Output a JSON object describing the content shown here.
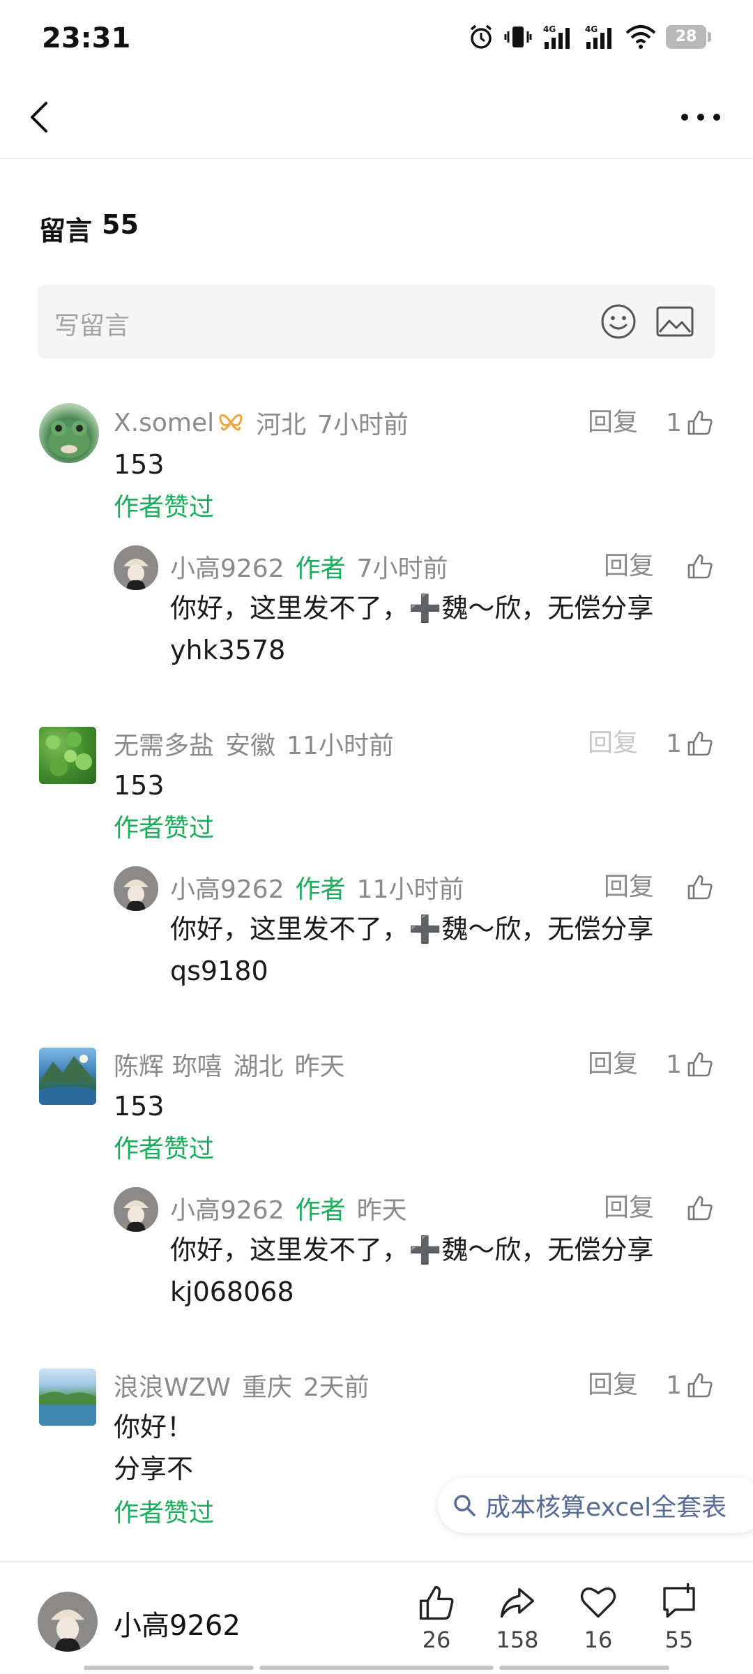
{
  "status": {
    "time": "23:31",
    "battery": "28",
    "net1": "4G",
    "net2": "4G"
  },
  "nav": {
    "back_icon": "chevron-left-icon",
    "more_icon": "more-dots-icon"
  },
  "comments_header": {
    "label": "留言",
    "count": "55"
  },
  "input": {
    "placeholder": "写留言"
  },
  "comments": [
    {
      "user": "X.somel",
      "region": "河北",
      "time": "7小时前",
      "reply": "回复",
      "likes": "1",
      "text": "153",
      "liked_by_author": "作者赞过",
      "author_reply": {
        "user": "小高9262",
        "tag": "作者",
        "time": "7小时前",
        "reply": "回复",
        "line1": "你好，这里发不了，➕魏～欣，无偿分享",
        "line2": "yhk3578"
      }
    },
    {
      "user": "无需多盐",
      "region": "安徽",
      "time": "11小时前",
      "reply": "回复",
      "likes": "1",
      "text": "153",
      "liked_by_author": "作者赞过",
      "author_reply": {
        "user": "小高9262",
        "tag": "作者",
        "time": "11小时前",
        "reply": "回复",
        "line1": "你好，这里发不了，➕魏～欣，无偿分享",
        "line2": "qs9180"
      }
    },
    {
      "user": "陈辉 珎嘻",
      "region": "湖北",
      "time": "昨天",
      "reply": "回复",
      "likes": "1",
      "text": "153",
      "liked_by_author": "作者赞过",
      "author_reply": {
        "user": "小高9262",
        "tag": "作者",
        "time": "昨天",
        "reply": "回复",
        "line1": "你好，这里发不了，➕魏～欣，无偿分享",
        "line2": "kj068068"
      }
    },
    {
      "user": "浪浪WZW",
      "region": "重庆",
      "time": "2天前",
      "reply": "回复",
      "likes": "1",
      "text": "你好！",
      "text2": "分享不",
      "liked_by_author": "作者赞过"
    }
  ],
  "search_chip": {
    "label": "成本核算excel全套表"
  },
  "bottom": {
    "author": "小高9262",
    "likes": "26",
    "shares": "158",
    "favorites": "16",
    "comments": "55"
  },
  "colors": {
    "green": "#1aad5a",
    "gray": "#8a8a8a",
    "link": "#576b95"
  }
}
